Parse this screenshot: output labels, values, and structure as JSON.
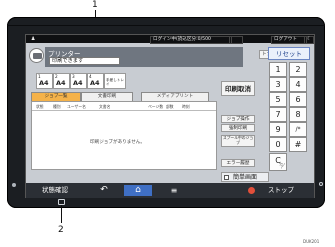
{
  "callouts": {
    "top": "1",
    "bottom": "2",
    "figure_code": "DUK201"
  },
  "status_bar": {
    "login_text": "ログイン中(読込区分:0/500",
    "logout_label": "ログアウト"
  },
  "app": {
    "title": "プリンター",
    "ready_text": "印刷できます",
    "toner_label": "トナー残量",
    "trays": [
      {
        "num": "1",
        "size": "A4"
      },
      {
        "num": "2",
        "size": "A4"
      },
      {
        "num": "3",
        "size": "A4"
      },
      {
        "num": "4",
        "size": "A4"
      }
    ],
    "bypass_label": "手差しトレイ",
    "tabs": [
      "ジョブ一覧",
      "文書印刷",
      "メディアプリント"
    ],
    "list_headers": [
      "状態",
      "種別",
      "ユーザー名",
      "文書名",
      "ページ数",
      "部数",
      "時刻"
    ],
    "empty_message": "印刷ジョブがありません。",
    "right_buttons": {
      "cancel_print": "印刷取消",
      "job_ops": "ジョブ操作",
      "forced_print": "強制印刷",
      "spool_label": "スプール中のジョブ",
      "error_history": "エラー履歴"
    },
    "simple_screen": "簡単画面"
  },
  "keypad": {
    "reset": "リセット",
    "keys": [
      "1",
      "2",
      "3",
      "4",
      "5",
      "6",
      "7",
      "8",
      "9",
      "/*",
      "0",
      "#",
      "C"
    ],
    "clear_sub": "クリア"
  },
  "nav": {
    "status_check": "状態確認",
    "back": "↶",
    "home": "⌂",
    "menu": "≡",
    "stop": "ストップ"
  }
}
